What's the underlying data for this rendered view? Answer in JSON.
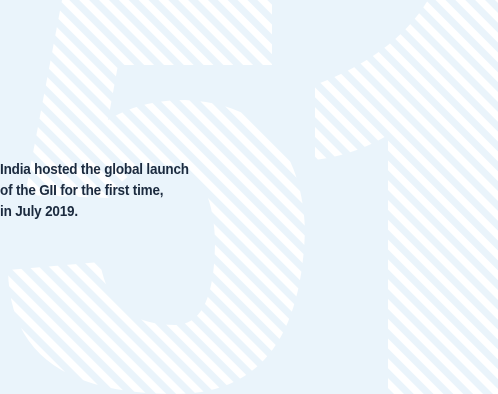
{
  "graphic": {
    "numeral": "51",
    "background_color": "#eaf4fb",
    "stripe_color": "#ffffff"
  },
  "caption": {
    "lines": [
      "India hosted the global launch",
      "of the GII for the first time,",
      "in July 2019."
    ]
  }
}
